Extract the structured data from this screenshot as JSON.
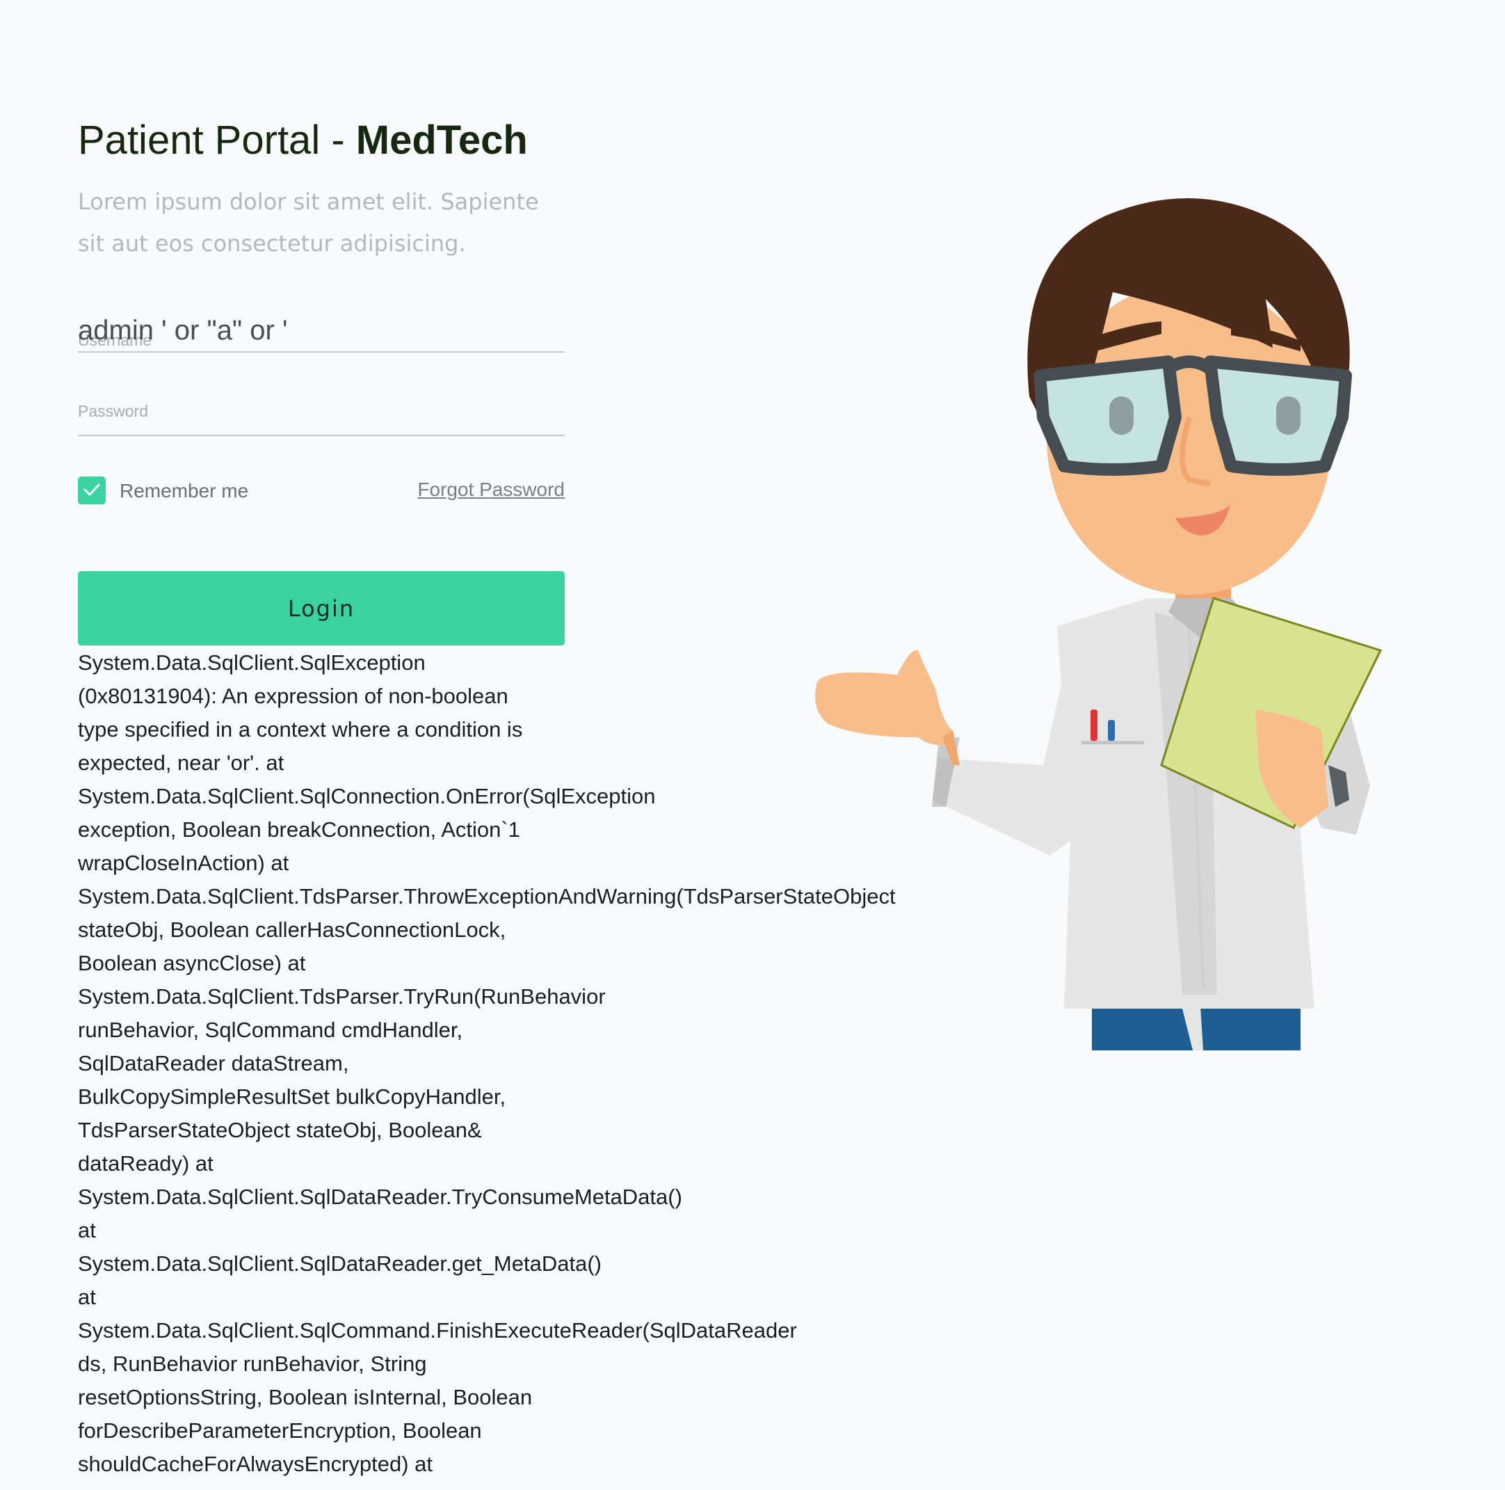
{
  "page": {
    "title_prefix": "Patient Portal - ",
    "title_brand": "MedTech",
    "subtitle": "Lorem ipsum dolor sit amet elit. Sapiente sit aut eos consectetur adipisicing."
  },
  "form": {
    "username_label": "Username",
    "username_value": "admin ' or \"a\" or '",
    "password_label": "Password",
    "password_value": "",
    "remember_label": "Remember me",
    "remember_checked": true,
    "forgot_label": "Forgot Password",
    "login_label": "Login"
  },
  "error": {
    "lines": [
      "System.Data.SqlClient.SqlException",
      "(0x80131904): An expression of non-boolean",
      "type specified in a context where a condition is",
      "expected, near 'or'. at",
      "System.Data.SqlClient.SqlConnection.OnError(SqlException",
      "exception, Boolean breakConnection, Action`1",
      "wrapCloseInAction) at",
      "System.Data.SqlClient.TdsParser.ThrowExceptionAndWarning(TdsParserStateObject",
      "stateObj, Boolean callerHasConnectionLock,",
      "Boolean asyncClose) at",
      "System.Data.SqlClient.TdsParser.TryRun(RunBehavior",
      "runBehavior, SqlCommand cmdHandler,",
      "SqlDataReader dataStream,",
      "BulkCopySimpleResultSet bulkCopyHandler,",
      "TdsParserStateObject stateObj, Boolean&",
      "dataReady) at",
      "System.Data.SqlClient.SqlDataReader.TryConsumeMetaData()",
      "at",
      "System.Data.SqlClient.SqlDataReader.get_MetaData()",
      "at",
      "System.Data.SqlClient.SqlCommand.FinishExecuteReader(SqlDataReader",
      "ds, RunBehavior runBehavior, String",
      "resetOptionsString, Boolean isInternal, Boolean",
      "forDescribeParameterEncryption, Boolean",
      "shouldCacheForAlwaysEncrypted) at"
    ]
  },
  "colors": {
    "accent": "#3ad29f",
    "background": "#f8fafb",
    "title": "#16280f"
  },
  "icons": {
    "checkbox": "check-icon",
    "illustration": "doctor-illustration"
  }
}
